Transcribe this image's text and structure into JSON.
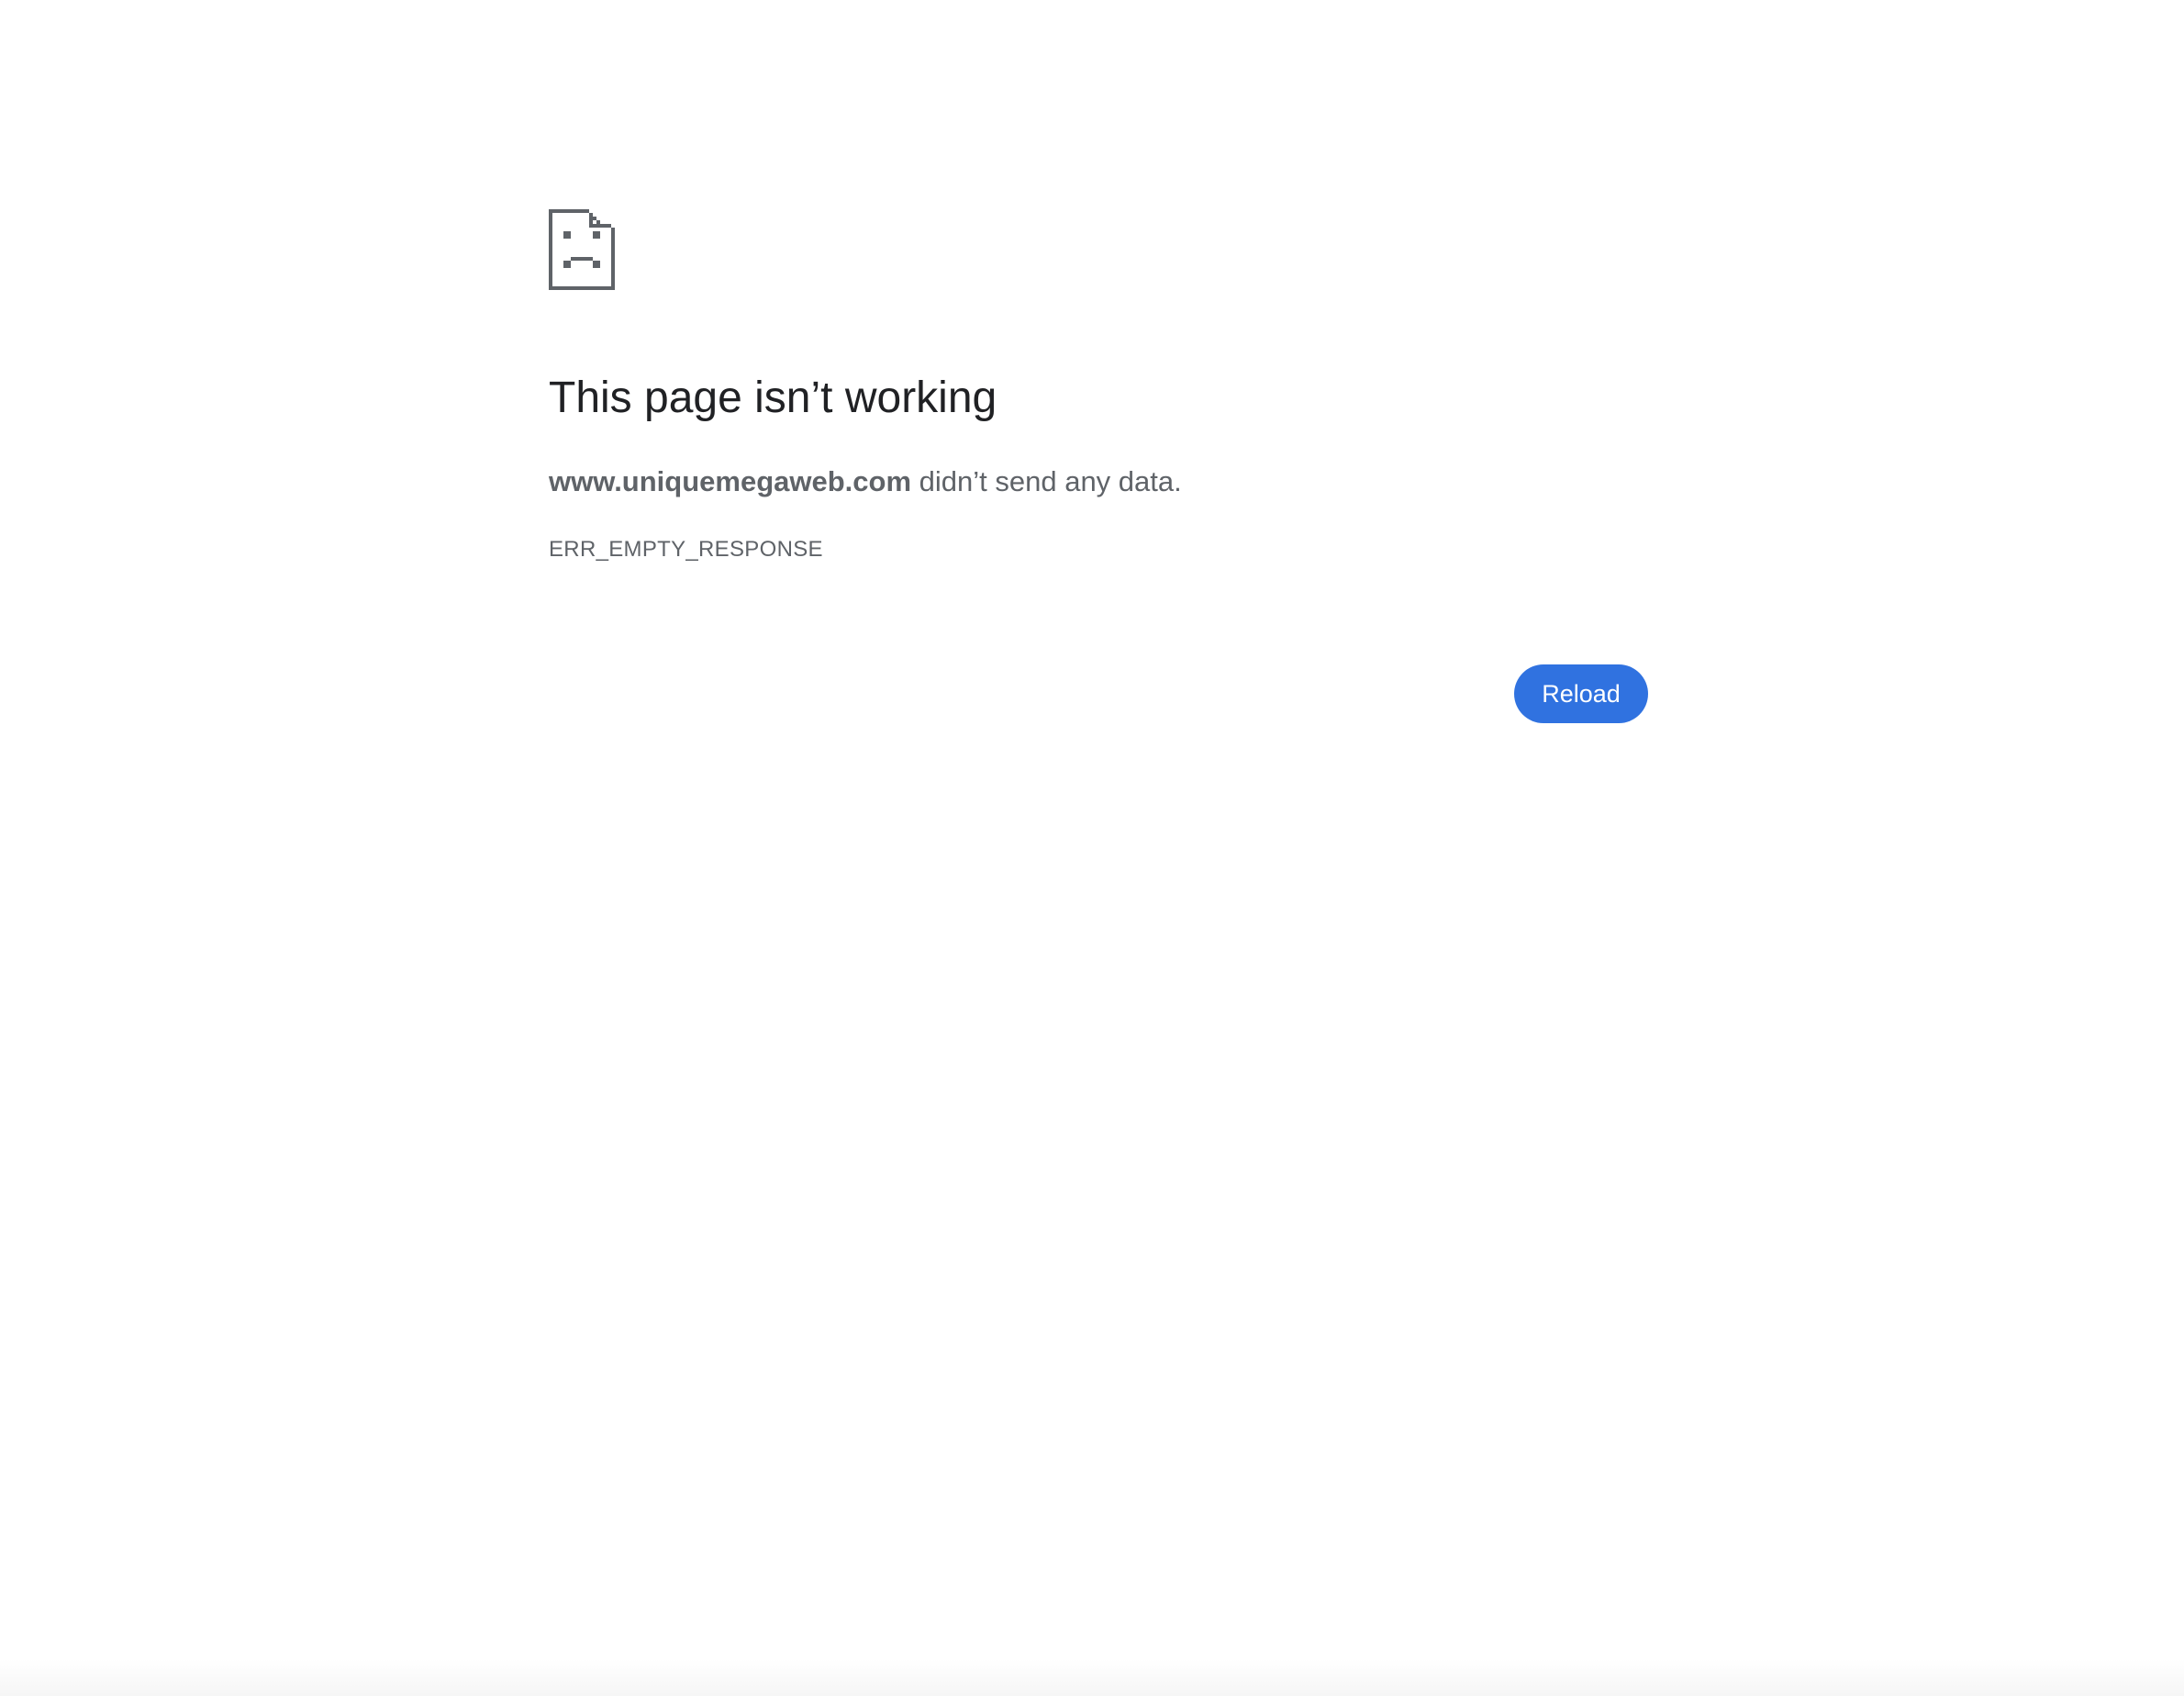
{
  "page": {
    "background_color": "#ffffff"
  },
  "icon": {
    "name": "sad-page-icon",
    "color": "#5f6368"
  },
  "title": "This page isn’t working",
  "summary": {
    "host": "www.uniquemegaweb.com",
    "message": " didn’t send any data."
  },
  "error_code": "ERR_EMPTY_RESPONSE",
  "reload_button": {
    "label": "Reload",
    "color": "#3072e0",
    "text_color": "#ffffff"
  },
  "colors": {
    "title": "#202124",
    "secondary_text": "#5f6368"
  }
}
